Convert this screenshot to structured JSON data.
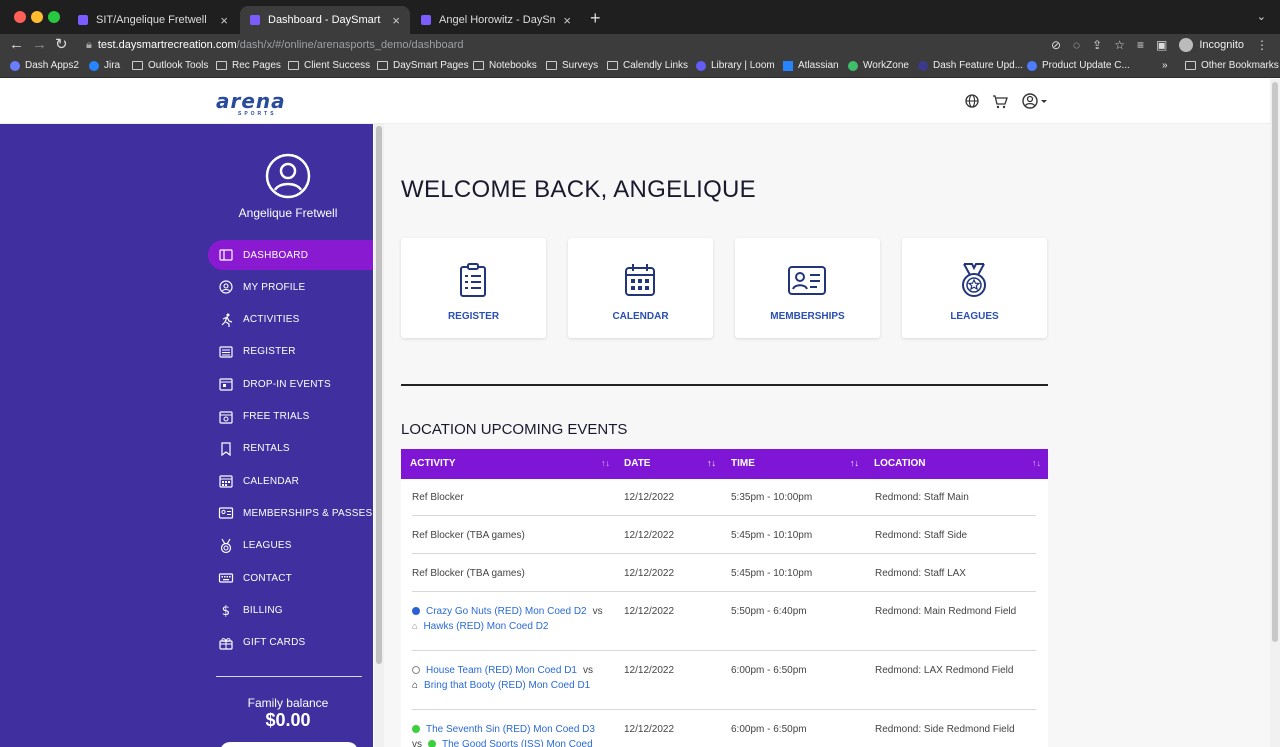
{
  "browser": {
    "tabs": [
      {
        "title": "SIT/Angelique Fretwell",
        "active": false
      },
      {
        "title": "Dashboard - DaySmart Recreation",
        "active": true
      },
      {
        "title": "Angel Horowitz - DaySmart Re",
        "active": false
      }
    ],
    "url_host": "test.daysmartrecreation.com",
    "url_path": "/dash/x/#/online/arenasports_demo/dashboard",
    "profile": "Incognito",
    "bookmarks": [
      "Dash Apps2",
      "Jira",
      "Outlook Tools",
      "Rec Pages",
      "Client Success",
      "DaySmart Pages",
      "Notebooks",
      "Surveys",
      "Calendly Links",
      "Library | Loom",
      "Atlassian",
      "WorkZone",
      "Dash Feature Upd...",
      "Product Update C...",
      "Other Bookmarks"
    ],
    "bookmarks_more": "»"
  },
  "site": {
    "logo_text": "arena",
    "logo_sub": "SPORTS",
    "header_icons": [
      "globe-icon",
      "cart-icon",
      "user-icon"
    ]
  },
  "sidebar": {
    "user_name": "Angelique Fretwell",
    "items": [
      {
        "label": "DASHBOARD",
        "icon": "dashboard-icon",
        "active": true
      },
      {
        "label": "MY PROFILE",
        "icon": "profile-icon",
        "active": false
      },
      {
        "label": "ACTIVITIES",
        "icon": "activities-icon",
        "active": false
      },
      {
        "label": "REGISTER",
        "icon": "register-icon",
        "active": false
      },
      {
        "label": "DROP-IN EVENTS",
        "icon": "drop-in-icon",
        "active": false
      },
      {
        "label": "FREE TRIALS",
        "icon": "free-trials-icon",
        "active": false
      },
      {
        "label": "RENTALS",
        "icon": "bookmark-icon",
        "active": false
      },
      {
        "label": "CALENDAR",
        "icon": "calendar-icon",
        "active": false
      },
      {
        "label": "MEMBERSHIPS & PASSES",
        "icon": "membership-icon",
        "active": false
      },
      {
        "label": "LEAGUES",
        "icon": "medal-icon",
        "active": false
      },
      {
        "label": "CONTACT",
        "icon": "keyboard-icon",
        "active": false
      },
      {
        "label": "BILLING",
        "icon": "dollar-icon",
        "active": false
      },
      {
        "label": "GIFT CARDS",
        "icon": "gift-icon",
        "active": false
      }
    ],
    "family_balance_label": "Family balance",
    "family_balance_value": "$0.00"
  },
  "main": {
    "welcome": "WELCOME BACK, ANGELIQUE",
    "cards": [
      {
        "label": "REGISTER",
        "icon": "clipboard-icon"
      },
      {
        "label": "CALENDAR",
        "icon": "calendar-icon"
      },
      {
        "label": "MEMBERSHIPS",
        "icon": "id-card-icon"
      },
      {
        "label": "LEAGUES",
        "icon": "medal-icon"
      }
    ],
    "events_title": "LOCATION UPCOMING EVENTS",
    "columns": [
      "ACTIVITY",
      "DATE",
      "TIME",
      "LOCATION"
    ],
    "rows": [
      {
        "activity": "Ref Blocker",
        "date": "12/12/2022",
        "time": "5:35pm - 10:00pm",
        "location": "Redmond: Staff Main"
      },
      {
        "activity": "Ref Blocker (TBA games)",
        "date": "12/12/2022",
        "time": "5:45pm - 10:10pm",
        "location": "Redmond: Staff Side"
      },
      {
        "activity": "Ref Blocker (TBA games)",
        "date": "12/12/2022",
        "time": "5:45pm - 10:10pm",
        "location": "Redmond: Staff LAX"
      },
      {
        "team1": "Crazy Go Nuts (RED) Mon Coed D2",
        "vs": "vs",
        "team2": "Hawks (RED) Mon Coed D2",
        "date": "12/12/2022",
        "time": "5:50pm - 6:40pm",
        "location": "Redmond: Main Redmond Field",
        "color1": "#2a5fd6",
        "color2": "home-outline"
      },
      {
        "team1": "House Team (RED) Mon Coed D1",
        "vs": "vs",
        "team2": "Bring that Booty (RED) Mon Coed D1",
        "date": "12/12/2022",
        "time": "6:00pm - 6:50pm",
        "location": "Redmond: LAX Redmond Field",
        "color1": "#ffffff",
        "color2": "home-filled"
      },
      {
        "team1": "The Seventh Sin (RED) Mon Coed D3",
        "vs": "vs",
        "team2": "The Good Sports (ISS) Mon Coed",
        "date": "12/12/2022",
        "time": "6:00pm - 6:50pm",
        "location": "Redmond: Side Redmond Field",
        "color1": "#3ecf3e",
        "color2": "#3ecf3e"
      }
    ],
    "sort_glyph": "↑↓"
  }
}
